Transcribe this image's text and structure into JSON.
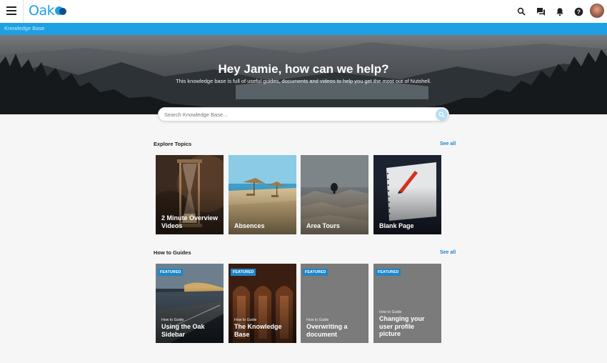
{
  "header": {
    "logo_text": "Oak",
    "icons": [
      "menu-icon",
      "search-icon",
      "chat-icon",
      "bell-icon",
      "help-icon"
    ],
    "brand_color": "#1ea1e3"
  },
  "breadcrumb": "Knowledge Base",
  "hero": {
    "title": "Hey Jamie, how can we help?",
    "subtitle": "This knowledge base is full of useful guides, documents and videos to help you get the most out of Nutshell."
  },
  "search": {
    "placeholder": "Search Knowledge Base..."
  },
  "explore": {
    "title": "Explore Topics",
    "see_all": "See all",
    "cards": [
      {
        "title": "2 Minute Overview Videos"
      },
      {
        "title": "Absences"
      },
      {
        "title": "Area Tours"
      },
      {
        "title": "Blank Page"
      }
    ]
  },
  "guides": {
    "title": "How to Guides",
    "see_all": "See all",
    "cards": [
      {
        "badge": "FEATURED",
        "kicker": "How to Guide",
        "title": "Using the Oak Sidebar"
      },
      {
        "badge": "FEATURED",
        "kicker": "How to Guide",
        "title": "The Knowledge Base"
      },
      {
        "badge": "FEATURED",
        "kicker": "How to Guide",
        "title": "Overwriting a document"
      },
      {
        "badge": "FEATURED",
        "kicker": "How to Guide",
        "title": "Changing your user profile picture"
      }
    ]
  }
}
